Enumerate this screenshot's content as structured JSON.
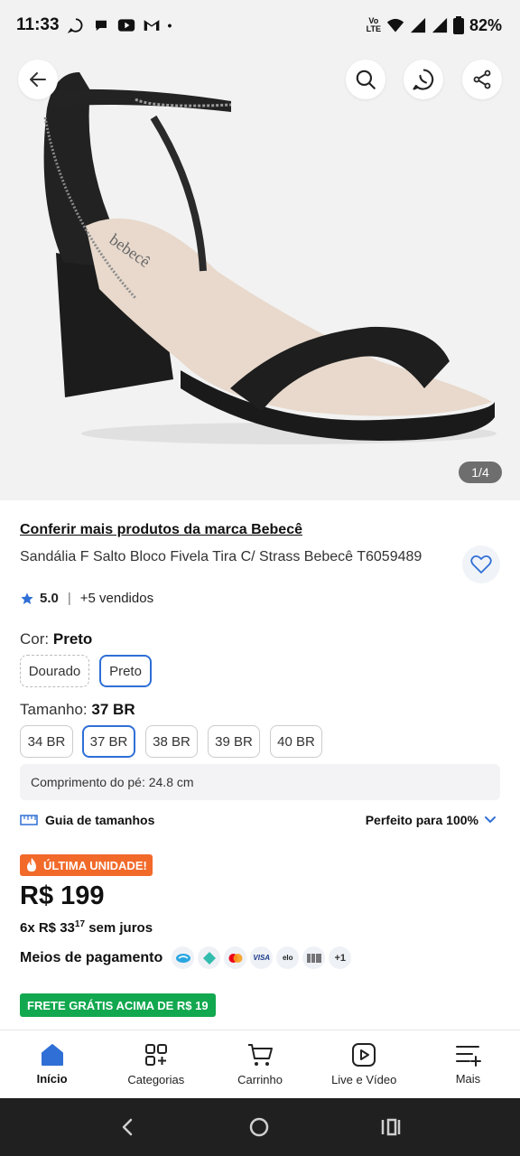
{
  "status_bar": {
    "time": "11:33",
    "battery": "82%"
  },
  "hero": {
    "counter": "1/4",
    "shoe_brand_print": "bebecê"
  },
  "product": {
    "brand_link": "Conferir mais produtos da marca Bebecê",
    "title": "Sandália F Salto Bloco Fivela Tira C/ Strass Bebecê T6059489",
    "rating": "5.0",
    "sold": "+5 vendidos"
  },
  "color": {
    "label": "Cor:",
    "selected": "Preto",
    "options": [
      "Dourado",
      "Preto"
    ]
  },
  "size": {
    "label": "Tamanho:",
    "selected": "37 BR",
    "options": [
      "34 BR",
      "37 BR",
      "38 BR",
      "39 BR",
      "40 BR"
    ],
    "foot_length": "Comprimento do pé: 24.8 cm",
    "guide": "Guia de tamanhos",
    "fit": "Perfeito para 100%"
  },
  "pricing": {
    "last_unit": "ÚLTIMA UNIDADE!",
    "price": "R$ 199",
    "installments_prefix": "6x R$ 33",
    "installments_cents": "17",
    "installments_suffix": "sem juros",
    "payments_label": "Meios de pagamento",
    "payment_more": "+1",
    "free_shipping": "FRETE GRÁTIS ACIMA DE R$ 19"
  },
  "bottom_nav": [
    {
      "label": "Início",
      "icon": "home-icon"
    },
    {
      "label": "Categorias",
      "icon": "categories-icon"
    },
    {
      "label": "Carrinho",
      "icon": "cart-icon"
    },
    {
      "label": "Live e Vídeo",
      "icon": "video-icon"
    },
    {
      "label": "Mais",
      "icon": "more-icon"
    }
  ],
  "colors": {
    "accent": "#2f6fd6",
    "orange": "#f26a2a",
    "green": "#12a84f"
  }
}
